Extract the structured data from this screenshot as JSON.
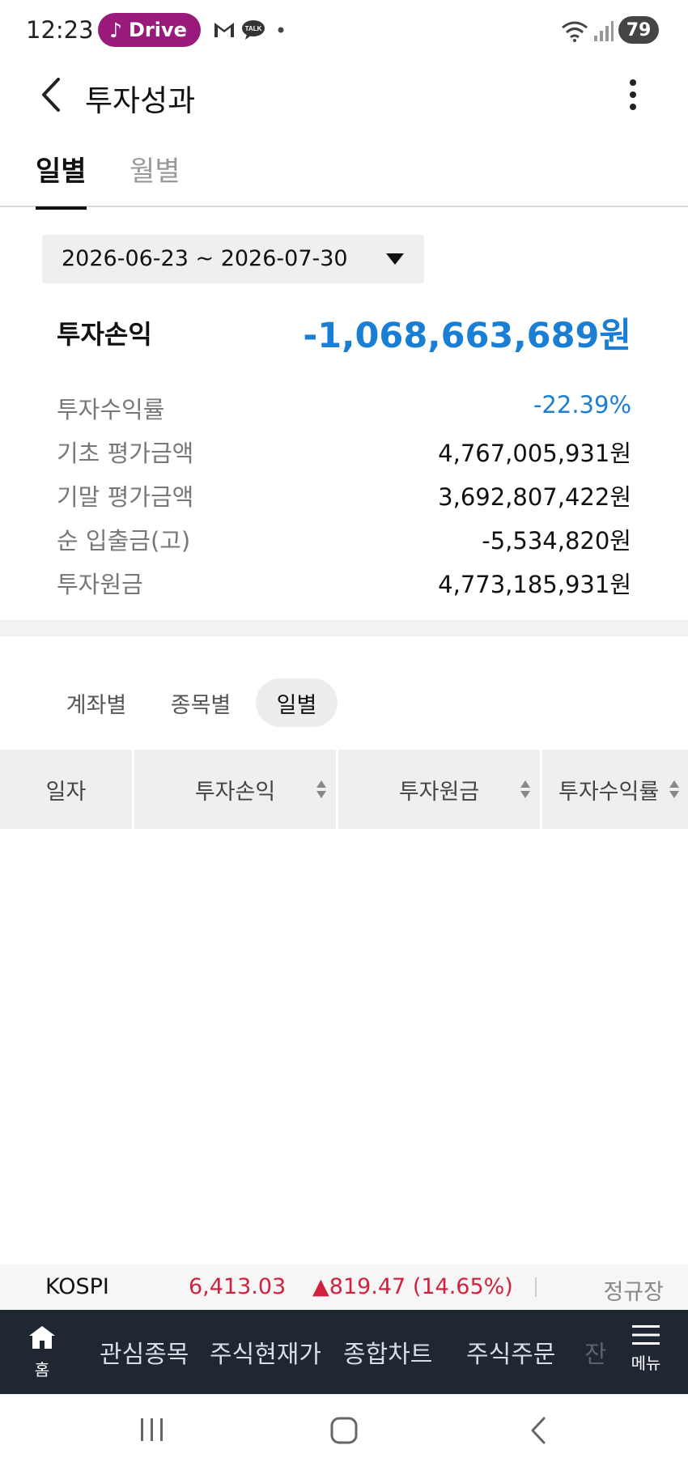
{
  "status_bar": {
    "time": "12:23",
    "drive_label": "Drive",
    "battery": "79",
    "icons": [
      "music-note-icon",
      "gmail-icon",
      "kakaotalk-icon",
      "dot-icon",
      "wifi-icon",
      "signal-icon"
    ]
  },
  "header": {
    "title": "투자성과",
    "back_icon": "chevron-left-icon",
    "more_icon": "more-vertical-icon"
  },
  "top_tabs": [
    {
      "label": "일별",
      "active": true
    },
    {
      "label": "월별",
      "active": false
    }
  ],
  "date_range": {
    "value": "2026-06-23 ~ 2026-07-30"
  },
  "summary": {
    "pl_label": "투자손익",
    "pl_value": "-1,068,663,689원",
    "rows": [
      {
        "label": "투자수익률",
        "value": "-22.39%"
      },
      {
        "label": "기초 평가금액",
        "value": "4,767,005,931원"
      },
      {
        "label": "기말 평가금액",
        "value": "3,692,807,422원"
      },
      {
        "label": "순 입출금(고)",
        "value": "-5,534,820원"
      },
      {
        "label": "투자원금",
        "value": "4,773,185,931원"
      }
    ]
  },
  "sub_tabs": [
    {
      "label": "계좌별",
      "active": false
    },
    {
      "label": "종목별",
      "active": false
    },
    {
      "label": "일별",
      "active": true
    }
  ],
  "table": {
    "columns": [
      "일자",
      "투자손익",
      "투자원금",
      "투자수익률"
    ],
    "rows": []
  },
  "ticker": {
    "name": "KOSPI",
    "price": "6,413.03",
    "change": "▲819.47 (14.65%)",
    "session": "정규장"
  },
  "bottom_nav": {
    "home_label": "홈",
    "items": [
      "관심종목",
      "주식현재가",
      "종합차트",
      "주식주문",
      "잔"
    ],
    "menu_label": "메뉴"
  },
  "colors": {
    "accent_blue": "#1a7fd4",
    "up_red": "#d0213f",
    "nav_bg": "#1f2733",
    "drive_pill": "#9a1a7c"
  }
}
